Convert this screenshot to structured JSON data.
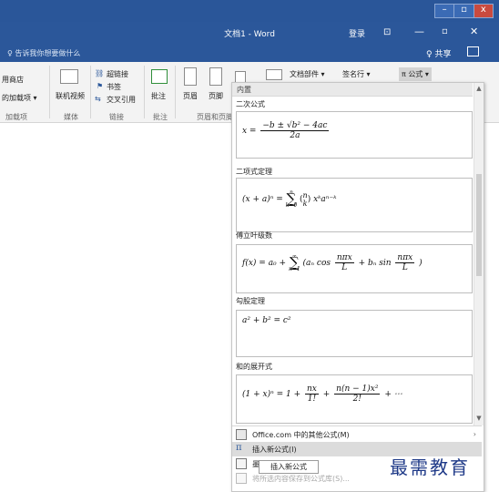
{
  "window": {
    "title": "文档1 - Word",
    "login": "登录",
    "ribbon_display_icon": "ribbon-display-icon",
    "minimize": "—",
    "maximize": "▫",
    "close": "✕",
    "top_controls": [
      "–",
      "▫",
      "x"
    ]
  },
  "tellme": {
    "placeholder": "♀ 告诉我你想要做什么",
    "share": "♀ 共享"
  },
  "ribbon": {
    "items": {
      "store": "用商店",
      "addins": "的加载项 ▾",
      "online_video": "联机视频",
      "hyperlink": "超链接",
      "bookmark": "书签",
      "crossref": "交叉引用",
      "comment": "批注",
      "header": "页眉",
      "footer": "页脚",
      "textbox": "文档部件 ▾",
      "signature": "签名行 ▾",
      "equation": "π 公式 ▾"
    },
    "groups": {
      "addins": "加载项",
      "media": "媒体",
      "links": "链接",
      "comments": "批注",
      "header_footer": "页眉和页脚"
    }
  },
  "equation_gallery": {
    "header": "内置",
    "entries": [
      {
        "name": "二次公式"
      },
      {
        "name": "二项式定理"
      },
      {
        "name": "傅立叶级数"
      },
      {
        "name": "勾股定理"
      },
      {
        "name": "和的展开式"
      }
    ],
    "formulas": {
      "quadratic": {
        "lhs": "x =",
        "num": "−b ± √b² − 4ac",
        "den": "2a"
      },
      "binomial": {
        "lhs": "(x + a)ⁿ =",
        "sigma": "∑",
        "upper": "n",
        "lower": "k=0",
        "binom_top": "n",
        "binom_bottom": "k",
        "tail": "xᵏaⁿ⁻ᵏ"
      },
      "fourier": {
        "lhs": "f(x) = a₀ +",
        "sigma": "∑",
        "upper": "∞",
        "lower": "n=1",
        "open": "(aₙ cos",
        "f1_num": "nπx",
        "f1_den": "L",
        "mid": "+ bₙ sin",
        "f2_num": "nπx",
        "f2_den": "L",
        "close": ")"
      },
      "pythagoras": {
        "text": "a² + b² = c²"
      },
      "sum_expansion": {
        "lhs": "(1 + x)ⁿ = 1 +",
        "f1_num": "nx",
        "f1_den": "1!",
        "plus": "+",
        "f2_num": "n(n − 1)x²",
        "f2_den": "2!",
        "tail": "+ ⋯"
      }
    },
    "menu": [
      {
        "label": "Office.com 中的其他公式(M)",
        "icon": "office-icon",
        "submenu": true
      },
      {
        "label": "插入新公式(I)",
        "icon": "pi-icon",
        "submenu": false
      },
      {
        "label": "墨迹公",
        "icon": "ink-equation-icon",
        "submenu": false
      },
      {
        "label": "将所选内容保存到公式库(S)...",
        "icon": "save-selection-icon",
        "submenu": false
      }
    ],
    "tooltip": "插入新公式",
    "scroll_up": "▲",
    "scroll_down": "▼",
    "chevron": "›"
  },
  "watermark": "最需教育",
  "colors": {
    "titlebar": "#2b579a",
    "ribbon": "#f3f3f3",
    "hover": "#dcdcdc"
  }
}
